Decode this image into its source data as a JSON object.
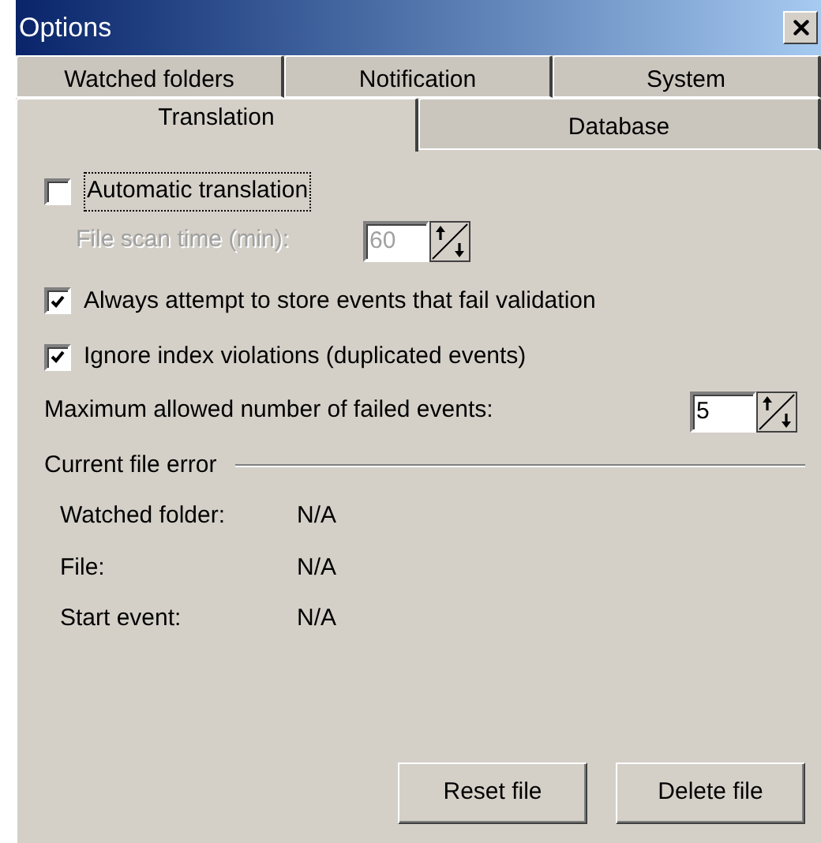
{
  "window": {
    "title": "Options"
  },
  "tab_rows": [
    {
      "tabs": [
        {
          "label": "Watched folders",
          "selected": false
        },
        {
          "label": "Notification",
          "selected": false
        },
        {
          "label": "System",
          "selected": false
        }
      ]
    },
    {
      "tabs": [
        {
          "label": "Translation",
          "selected": true
        },
        {
          "label": "Database",
          "selected": false
        }
      ]
    }
  ],
  "automatic_translation": {
    "label": "Automatic translation",
    "checked": false,
    "focused": true
  },
  "scan_time": {
    "label": "File scan time (min):",
    "value": "60",
    "disabled": true
  },
  "options": [
    {
      "label": "Always attempt to store events that fail validation",
      "checked": true
    },
    {
      "label": "Ignore index violations (duplicated events)",
      "checked": true
    }
  ],
  "max_failed": {
    "label": "Maximum allowed number of failed events:",
    "value": "5",
    "disabled": false
  },
  "current_file_error": {
    "title": "Current file error",
    "rows": [
      {
        "label": "Watched folder:",
        "value": "N/A"
      },
      {
        "label": "File:",
        "value": "N/A"
      },
      {
        "label": "Start event:",
        "value": "N/A"
      }
    ]
  },
  "buttons": [
    "Reset file",
    "Delete file"
  ]
}
